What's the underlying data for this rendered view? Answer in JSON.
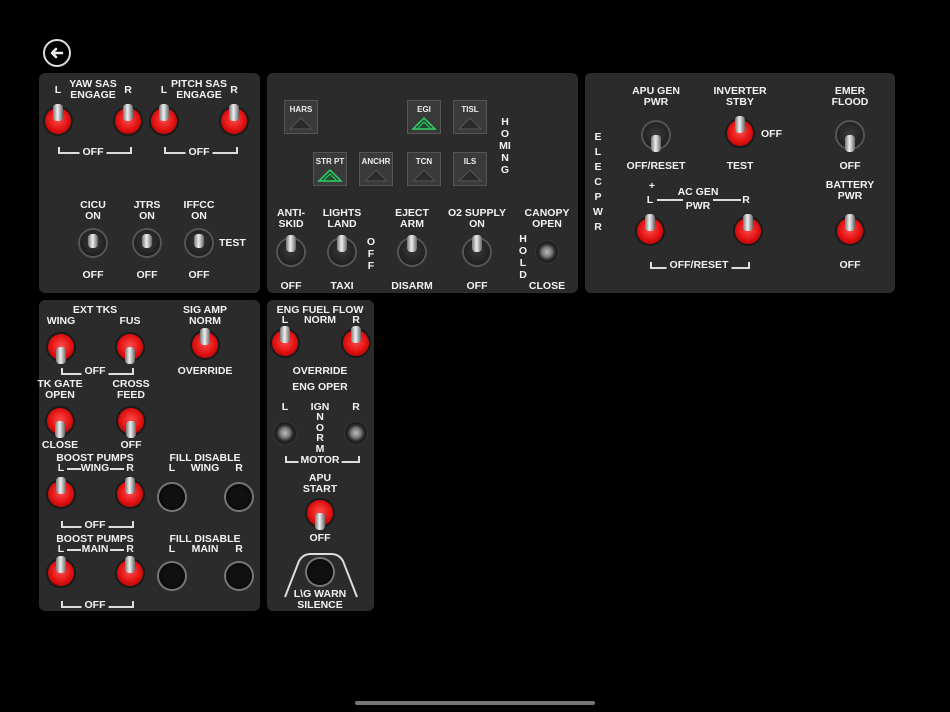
{
  "nav": {
    "back_icon": "arrow-left-circle-icon"
  },
  "panel_sas": {
    "yaw_sas": "YAW SAS\nENGAGE",
    "pitch_sas": "PITCH SAS\nENGAGE",
    "l": "L",
    "r": "R",
    "off": "OFF",
    "cicu": "CICU\nON",
    "jtrs": "JTRS\nON",
    "iffcc": "IFFCC\nON",
    "test": "TEST"
  },
  "panel_center": {
    "annunciators": [
      "HARS",
      "EGI",
      "TISL",
      "STR PT",
      "ANCHR",
      "TCN",
      "ILS"
    ],
    "homing": "HOMING",
    "anti_skid": "ANTI-\nSKID",
    "lights_land": "LIGHTS\nLAND",
    "off_v": "OFF",
    "eject_arm": "EJECT\nARM",
    "o2_supply": "O2 SUPPLY\nON",
    "canopy_open": "CANOPY\nOPEN",
    "hold_v": "HOLD",
    "off": "OFF",
    "taxi": "TAXI",
    "disarm": "DISARM",
    "close": "CLOSE"
  },
  "panel_elec": {
    "elec_pwr_v": "ELEC PWR",
    "apu_gen": "APU GEN\nPWR",
    "off_reset": "OFF/RESET",
    "inverter": "INVERTER\nSTBY",
    "off": "OFF",
    "test": "TEST",
    "emer_flood": "EMER\nFLOOD",
    "plus": "+",
    "ac_gen": "AC GEN",
    "pwr": "PWR",
    "l": "L",
    "r": "R",
    "off_reset_br": "OFF/RESET",
    "battery": "BATTERY\nPWR"
  },
  "panel_fuel": {
    "ext_tks": "EXT TKS",
    "wing": "WING",
    "fus": "FUS",
    "off": "OFF",
    "sig_amp": "SIG AMP\nNORM",
    "override": "OVERRIDE",
    "tk_gate": "TK GATE\nOPEN",
    "close": "CLOSE",
    "cross_feed": "CROSS\nFEED",
    "boost_pumps": "BOOST PUMPS",
    "l": "L",
    "r": "R",
    "wing_mid": "WING",
    "fill_disable": "FILL DISABLE",
    "main_mid": "MAIN"
  },
  "panel_eng": {
    "eng_fuel_flow": "ENG FUEL FLOW",
    "norm": "NORM",
    "l": "L",
    "r": "R",
    "override": "OVERRIDE",
    "eng_oper": "ENG OPER",
    "ign": "IGN",
    "norm_v": "NORM",
    "motor": "MOTOR",
    "apu_start": "APU\nSTART",
    "off": "OFF",
    "lg_warn": "L\\G WARN\nSILENCE"
  },
  "colors": {
    "panel": "#2b2b2b",
    "red_switch": "#e01010",
    "green_light": "#2fd36a"
  }
}
